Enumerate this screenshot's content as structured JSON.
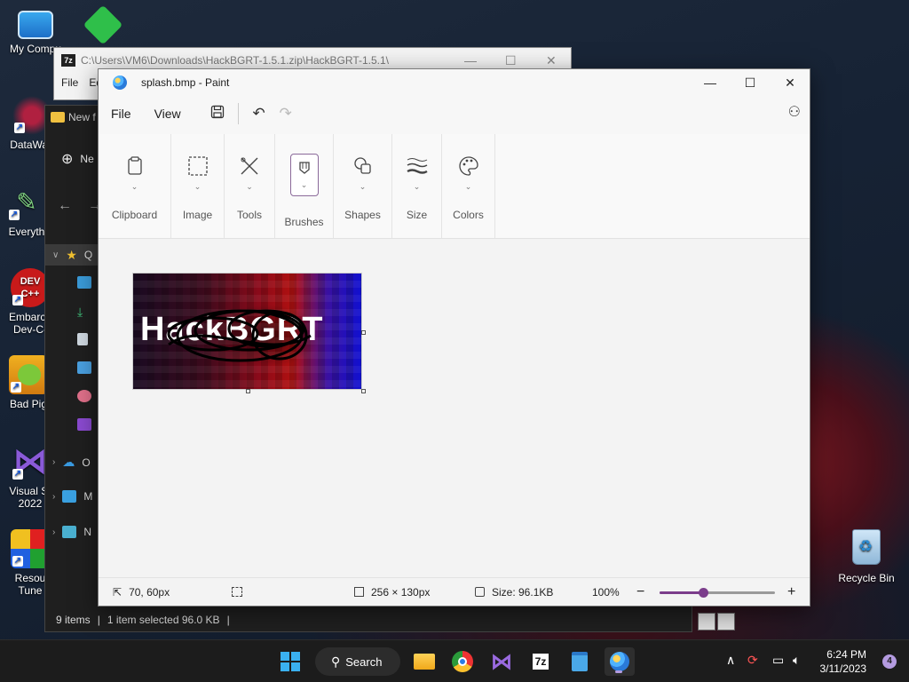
{
  "desktop": {
    "icons": [
      {
        "label": "My Compu",
        "icon": "computer-icon"
      },
      {
        "label": "DataWag",
        "icon": "datawag-icon"
      },
      {
        "label": "Everyth",
        "icon": "everything-icon"
      },
      {
        "label": "Embarca\nDev-C-",
        "icon": "devcpp-icon",
        "logo_text": "DEV C++"
      },
      {
        "label": "Bad Pig",
        "icon": "bad-piggies-icon"
      },
      {
        "label": "Visual St\n2022",
        "icon": "visual-studio-icon"
      },
      {
        "label": "Resou\nTune",
        "icon": "resource-tuner-icon"
      }
    ],
    "recycle_bin_label": "Recycle Bin"
  },
  "window_7zip": {
    "title": "C:\\Users\\VM6\\Downloads\\HackBGRT-1.5.1.zip\\HackBGRT-1.5.1\\",
    "logo_text": "7z",
    "menu": [
      "File",
      "Ed"
    ]
  },
  "window_explorer": {
    "tab_label": "New f",
    "new_button": "Ne",
    "sidebar": {
      "quick_access": "Q",
      "onedrive": "O",
      "this_pc": "M",
      "network": "N"
    },
    "status": {
      "items": "9 items",
      "selected": "1 item selected  96.0 KB"
    }
  },
  "paint": {
    "title": "splash.bmp - Paint",
    "menu": {
      "file": "File",
      "view": "View"
    },
    "ribbon": [
      {
        "label": "Clipboard",
        "icon": "clipboard-icon"
      },
      {
        "label": "Image",
        "icon": "selection-icon"
      },
      {
        "label": "Tools",
        "icon": "tools-icon"
      },
      {
        "label": "Brushes",
        "icon": "brush-icon"
      },
      {
        "label": "Shapes",
        "icon": "shapes-icon"
      },
      {
        "label": "Size",
        "icon": "size-icon"
      },
      {
        "label": "Colors",
        "icon": "palette-icon"
      }
    ],
    "image_text": "HackBGRT",
    "status": {
      "cursor_pos": "70, 60px",
      "dimensions": "256 × 130px",
      "size": "Size: 96.1KB",
      "zoom": "100%",
      "zoom_slider_fraction": 0.38
    },
    "accent_color": "#7b3d8b"
  },
  "taskbar": {
    "search_label": "Search",
    "apps": [
      "start-icon",
      "file-explorer-icon",
      "chrome-icon",
      "visual-studio-icon",
      "7zip-icon",
      "notepad-icon",
      "paint-icon"
    ],
    "app_7zip_label": "7z",
    "time": "6:24 PM",
    "date": "3/11/2023",
    "notification_count": "4"
  }
}
